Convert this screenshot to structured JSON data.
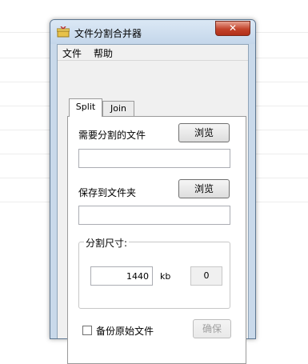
{
  "window": {
    "title": "文件分割合并器",
    "close_label": "✕"
  },
  "menu": {
    "file": "文件",
    "help": "帮助"
  },
  "tabs": [
    {
      "label": "Split",
      "selected": true
    },
    {
      "label": "Join",
      "selected": false
    }
  ],
  "split": {
    "source_label": "需要分割的文件",
    "browse_source": "浏览",
    "source_value": "",
    "dest_label": "保存到文件夹",
    "browse_dest": "浏览",
    "dest_value": "",
    "size_group_label": "分割尺寸:",
    "size_value": "1440",
    "size_unit": "kb",
    "parts_count": "0",
    "backup_label": "备份原始文件",
    "backup_checked": false,
    "confirm_label": "确保"
  },
  "colors": {
    "close_button": "#c2432b",
    "frame": "#c9d9ea"
  }
}
